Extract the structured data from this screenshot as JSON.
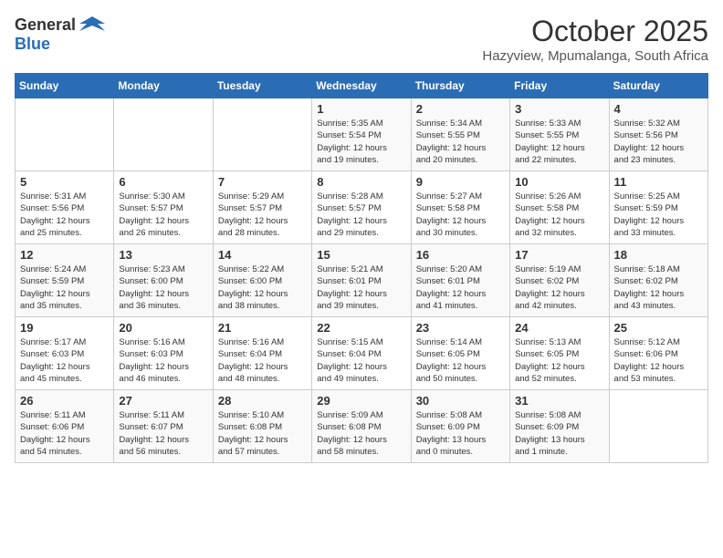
{
  "logo": {
    "general": "General",
    "blue": "Blue"
  },
  "title": "October 2025",
  "location": "Hazyview, Mpumalanga, South Africa",
  "days_of_week": [
    "Sunday",
    "Monday",
    "Tuesday",
    "Wednesday",
    "Thursday",
    "Friday",
    "Saturday"
  ],
  "weeks": [
    [
      {
        "day": "",
        "info": ""
      },
      {
        "day": "",
        "info": ""
      },
      {
        "day": "",
        "info": ""
      },
      {
        "day": "1",
        "info": "Sunrise: 5:35 AM\nSunset: 5:54 PM\nDaylight: 12 hours\nand 19 minutes."
      },
      {
        "day": "2",
        "info": "Sunrise: 5:34 AM\nSunset: 5:55 PM\nDaylight: 12 hours\nand 20 minutes."
      },
      {
        "day": "3",
        "info": "Sunrise: 5:33 AM\nSunset: 5:55 PM\nDaylight: 12 hours\nand 22 minutes."
      },
      {
        "day": "4",
        "info": "Sunrise: 5:32 AM\nSunset: 5:56 PM\nDaylight: 12 hours\nand 23 minutes."
      }
    ],
    [
      {
        "day": "5",
        "info": "Sunrise: 5:31 AM\nSunset: 5:56 PM\nDaylight: 12 hours\nand 25 minutes."
      },
      {
        "day": "6",
        "info": "Sunrise: 5:30 AM\nSunset: 5:57 PM\nDaylight: 12 hours\nand 26 minutes."
      },
      {
        "day": "7",
        "info": "Sunrise: 5:29 AM\nSunset: 5:57 PM\nDaylight: 12 hours\nand 28 minutes."
      },
      {
        "day": "8",
        "info": "Sunrise: 5:28 AM\nSunset: 5:57 PM\nDaylight: 12 hours\nand 29 minutes."
      },
      {
        "day": "9",
        "info": "Sunrise: 5:27 AM\nSunset: 5:58 PM\nDaylight: 12 hours\nand 30 minutes."
      },
      {
        "day": "10",
        "info": "Sunrise: 5:26 AM\nSunset: 5:58 PM\nDaylight: 12 hours\nand 32 minutes."
      },
      {
        "day": "11",
        "info": "Sunrise: 5:25 AM\nSunset: 5:59 PM\nDaylight: 12 hours\nand 33 minutes."
      }
    ],
    [
      {
        "day": "12",
        "info": "Sunrise: 5:24 AM\nSunset: 5:59 PM\nDaylight: 12 hours\nand 35 minutes."
      },
      {
        "day": "13",
        "info": "Sunrise: 5:23 AM\nSunset: 6:00 PM\nDaylight: 12 hours\nand 36 minutes."
      },
      {
        "day": "14",
        "info": "Sunrise: 5:22 AM\nSunset: 6:00 PM\nDaylight: 12 hours\nand 38 minutes."
      },
      {
        "day": "15",
        "info": "Sunrise: 5:21 AM\nSunset: 6:01 PM\nDaylight: 12 hours\nand 39 minutes."
      },
      {
        "day": "16",
        "info": "Sunrise: 5:20 AM\nSunset: 6:01 PM\nDaylight: 12 hours\nand 41 minutes."
      },
      {
        "day": "17",
        "info": "Sunrise: 5:19 AM\nSunset: 6:02 PM\nDaylight: 12 hours\nand 42 minutes."
      },
      {
        "day": "18",
        "info": "Sunrise: 5:18 AM\nSunset: 6:02 PM\nDaylight: 12 hours\nand 43 minutes."
      }
    ],
    [
      {
        "day": "19",
        "info": "Sunrise: 5:17 AM\nSunset: 6:03 PM\nDaylight: 12 hours\nand 45 minutes."
      },
      {
        "day": "20",
        "info": "Sunrise: 5:16 AM\nSunset: 6:03 PM\nDaylight: 12 hours\nand 46 minutes."
      },
      {
        "day": "21",
        "info": "Sunrise: 5:16 AM\nSunset: 6:04 PM\nDaylight: 12 hours\nand 48 minutes."
      },
      {
        "day": "22",
        "info": "Sunrise: 5:15 AM\nSunset: 6:04 PM\nDaylight: 12 hours\nand 49 minutes."
      },
      {
        "day": "23",
        "info": "Sunrise: 5:14 AM\nSunset: 6:05 PM\nDaylight: 12 hours\nand 50 minutes."
      },
      {
        "day": "24",
        "info": "Sunrise: 5:13 AM\nSunset: 6:05 PM\nDaylight: 12 hours\nand 52 minutes."
      },
      {
        "day": "25",
        "info": "Sunrise: 5:12 AM\nSunset: 6:06 PM\nDaylight: 12 hours\nand 53 minutes."
      }
    ],
    [
      {
        "day": "26",
        "info": "Sunrise: 5:11 AM\nSunset: 6:06 PM\nDaylight: 12 hours\nand 54 minutes."
      },
      {
        "day": "27",
        "info": "Sunrise: 5:11 AM\nSunset: 6:07 PM\nDaylight: 12 hours\nand 56 minutes."
      },
      {
        "day": "28",
        "info": "Sunrise: 5:10 AM\nSunset: 6:08 PM\nDaylight: 12 hours\nand 57 minutes."
      },
      {
        "day": "29",
        "info": "Sunrise: 5:09 AM\nSunset: 6:08 PM\nDaylight: 12 hours\nand 58 minutes."
      },
      {
        "day": "30",
        "info": "Sunrise: 5:08 AM\nSunset: 6:09 PM\nDaylight: 13 hours\nand 0 minutes."
      },
      {
        "day": "31",
        "info": "Sunrise: 5:08 AM\nSunset: 6:09 PM\nDaylight: 13 hours\nand 1 minute."
      },
      {
        "day": "",
        "info": ""
      }
    ]
  ]
}
